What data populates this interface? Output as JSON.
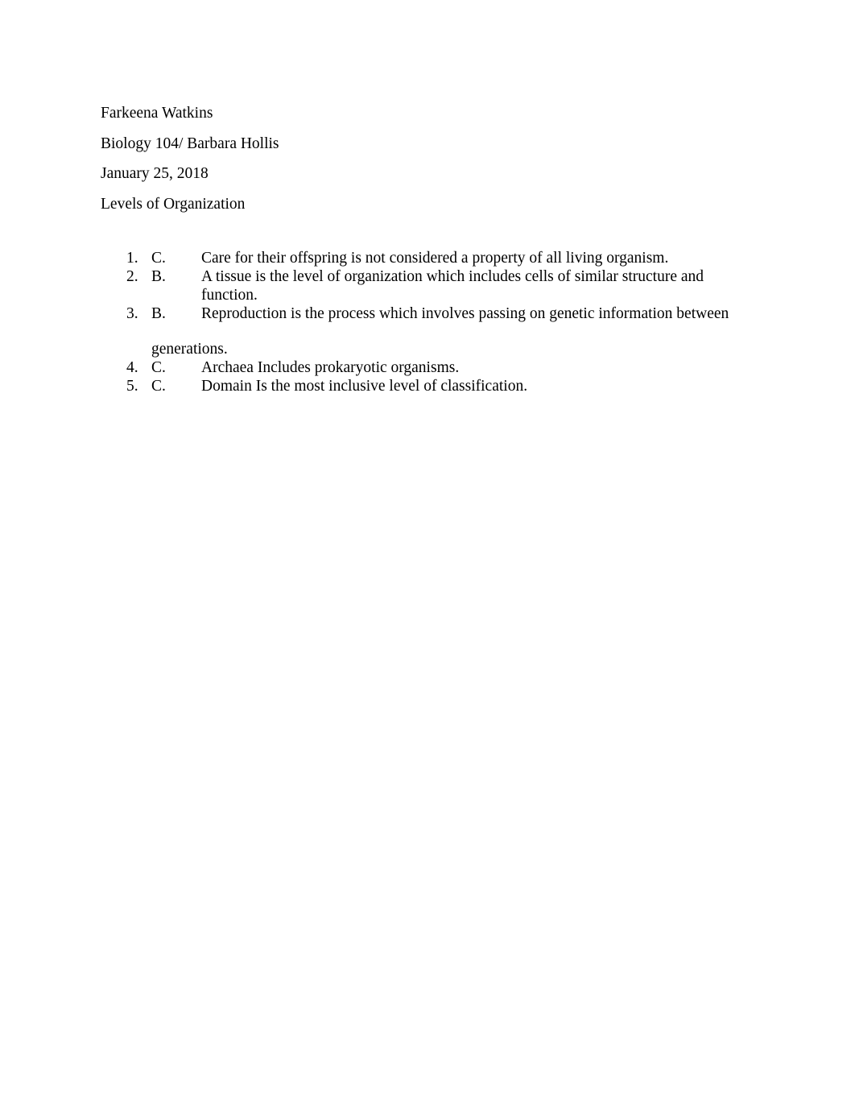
{
  "document": {
    "header_lines": [
      {
        "text": "Farkeena Watkins"
      },
      {
        "text": "Biology 104/ Barbara Hollis"
      },
      {
        "text": "January 25, 2018"
      },
      {
        "text": "Levels of Organization"
      }
    ],
    "answers": [
      {
        "number": "1.",
        "letter": "C.",
        "text": "Care for their offspring is not considered a property of all living organism.",
        "continuation": null
      },
      {
        "number": "2.",
        "letter": "B.",
        "text": "A tissue is the level of organization which includes cells of similar structure and function.",
        "continuation": null
      },
      {
        "number": "3.",
        "letter": "B.",
        "text": "Reproduction is the process which involves passing on genetic information between",
        "continuation": "generations."
      },
      {
        "number": "4.",
        "letter": "C.",
        "text": "Archaea Includes prokaryotic organisms.",
        "continuation": null
      },
      {
        "number": "5.",
        "letter": "C.",
        "text": "Domain Is the most inclusive level of classification.",
        "continuation": null
      }
    ]
  },
  "colors": {
    "page_background": "#ffffff",
    "text": "#000000"
  }
}
